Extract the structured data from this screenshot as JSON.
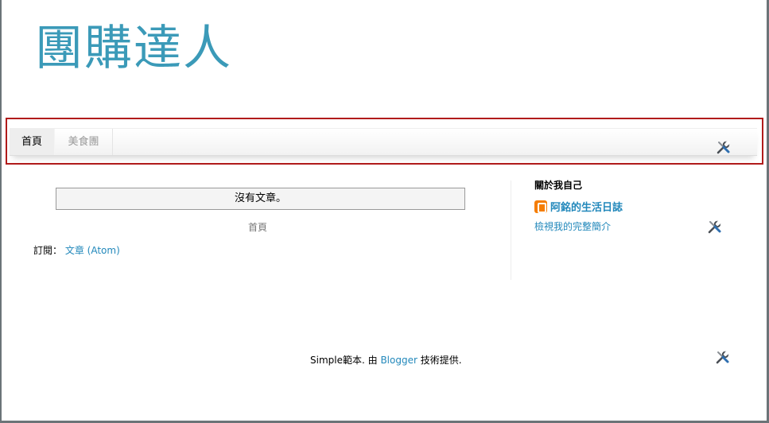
{
  "header": {
    "blog_title": "團購達人"
  },
  "tabs": [
    {
      "label": "首頁",
      "active": true
    },
    {
      "label": "美食團",
      "active": false
    }
  ],
  "main": {
    "status_text": "沒有文章。",
    "home_link": "首頁",
    "subscribe_label": "訂閱：",
    "subscribe_link": "文章 (Atom)"
  },
  "sidebar": {
    "about_title": "關於我自己",
    "profile_name": "阿銘的生活日誌",
    "profile_link": "檢視我的完整簡介"
  },
  "footer": {
    "prefix": "Simple範本. 由",
    "link": "Blogger",
    "suffix": "技術提供."
  },
  "icons": {
    "tools": "tools-icon",
    "blogger": "blogger-icon"
  },
  "colors": {
    "title": "#3b9ab8",
    "link": "#2288bb",
    "highlight_outline": "#b11b1b",
    "blogger_orange": "#f57d00"
  }
}
